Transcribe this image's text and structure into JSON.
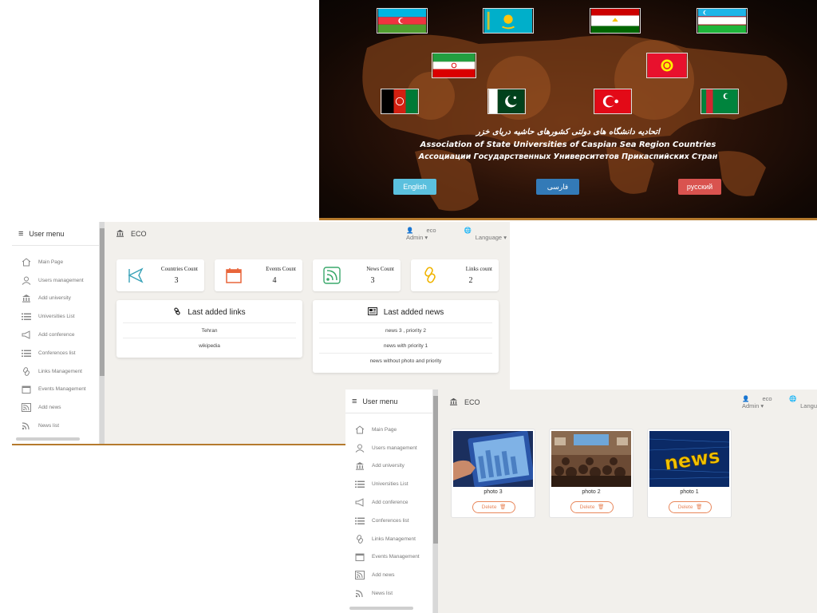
{
  "hero": {
    "title_fa": "اتحادیه دانشگاه های دولتی کشورهای حاشیه دریای خزر",
    "title_en": "Association of State Universities of Caspian Sea Region Countries",
    "title_ru": "Ассоциации Государственных Университетов Прикаспийских Стран",
    "buttons": [
      {
        "label": "English",
        "color": "#5bc0de"
      },
      {
        "label": "فارسی",
        "color": "#337ab7"
      },
      {
        "label": "русский",
        "color": "#d9534f"
      }
    ],
    "flags": [
      "azerbaijan-flag",
      "kazakhstan-flag",
      "tajikistan-flag",
      "uzbekistan-flag",
      "iran-flag",
      "kyrgyzstan-flag",
      "afghanistan-flag",
      "pakistan-flag",
      "turkey-flag",
      "turkmenistan-flag"
    ]
  },
  "sidebar": {
    "title": "User menu",
    "items": [
      {
        "label": "Main Page",
        "icon": "home-icon"
      },
      {
        "label": "Users management",
        "icon": "user-icon"
      },
      {
        "label": "Add university",
        "icon": "bank-icon"
      },
      {
        "label": "Universities List",
        "icon": "list-icon"
      },
      {
        "label": "Add conference",
        "icon": "megaphone-icon"
      },
      {
        "label": "Conferences list",
        "icon": "list-icon"
      },
      {
        "label": "Links Management",
        "icon": "link-icon"
      },
      {
        "label": "Events Management",
        "icon": "calendar-icon"
      },
      {
        "label": "Add news",
        "icon": "rss-icon"
      },
      {
        "label": "News list",
        "icon": "rss-icon"
      }
    ]
  },
  "header": {
    "brand": "ECO",
    "user": "eco Admin",
    "language": "Language",
    "language_short": "Langu"
  },
  "stats": [
    {
      "label": "Countries Count",
      "value": "3",
      "icon": "flag-icon",
      "color": "#3aa3b8"
    },
    {
      "label": "Events Count",
      "value": "4",
      "icon": "calendar-icon",
      "color": "#e8653a"
    },
    {
      "label": "News Count",
      "value": "3",
      "icon": "rss-icon",
      "color": "#3aa86b"
    },
    {
      "label": "Links count",
      "value": "2",
      "icon": "link-icon",
      "color": "#f0b400"
    }
  ],
  "links_card": {
    "title": "Last added links",
    "items": [
      "Tehran",
      "wikipedia"
    ]
  },
  "news_card": {
    "title": "Last added news",
    "items": [
      "news 3 , priority 2",
      "news with priority 1",
      "news without photo and priority"
    ]
  },
  "photos": [
    {
      "caption": "photo 3",
      "delete": "Delete",
      "image": "tablet-image"
    },
    {
      "caption": "photo 2",
      "delete": "Delete",
      "image": "conference-image"
    },
    {
      "caption": "photo 1",
      "delete": "Delete",
      "image": "news-image",
      "image_text": "news"
    }
  ]
}
